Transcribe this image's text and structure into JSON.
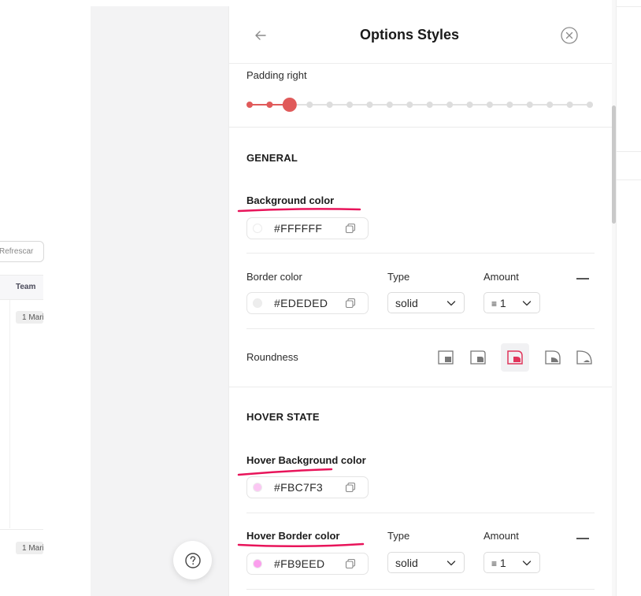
{
  "background": {
    "refresh_label": "Refrescar",
    "team_header": "Team",
    "row_tags": [
      "1 Mari",
      "1 Mari"
    ]
  },
  "help": {
    "icon": "question-circle-icon"
  },
  "panel": {
    "title": "Options Styles",
    "back_icon": "arrow-left-icon",
    "close_icon": "close-circle-icon",
    "padding_right": {
      "label": "Padding right",
      "steps": 18,
      "selected_index": 2
    },
    "general": {
      "title": "GENERAL",
      "background_color": {
        "label": "Background color",
        "value": "#FFFFFF",
        "swatch": "#FFFFFF"
      },
      "border_color": {
        "label": "Border color",
        "value": "#EDEDED",
        "swatch": "#EDEDED"
      },
      "type": {
        "label": "Type",
        "value": "solid"
      },
      "amount": {
        "label": "Amount",
        "prefix": "≡",
        "value": "1"
      },
      "roundness": {
        "label": "Roundness",
        "selected_index": 2
      }
    },
    "hover": {
      "title": "HOVER STATE",
      "background_color": {
        "label": "Hover Background color",
        "value": "#FBC7F3",
        "swatch": "#FBC7F3"
      },
      "border_color": {
        "label": "Hover Border color",
        "value": "#FB9EED",
        "swatch": "#FB9EED"
      },
      "type": {
        "label": "Type",
        "value": "solid"
      },
      "amount": {
        "label": "Amount",
        "prefix": "≡",
        "value": "1"
      }
    }
  },
  "colors": {
    "accent": "#E05A5A",
    "active_corner": "#E0345A",
    "annotation": "#E8145A"
  }
}
